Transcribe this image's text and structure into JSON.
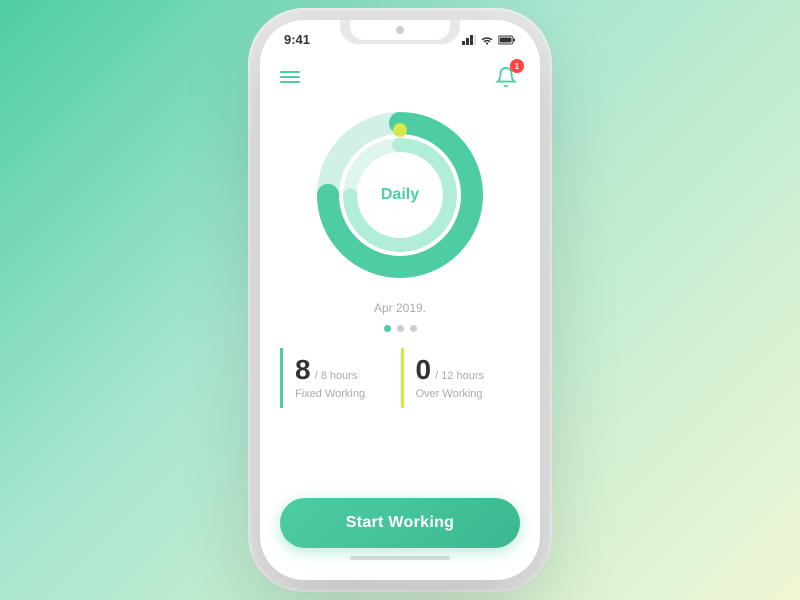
{
  "phone": {
    "status_bar": {
      "time": "9:41",
      "signal": "▲▲▲",
      "wifi": "wifi",
      "battery": "battery"
    },
    "header": {
      "menu_label": "menu",
      "notification_count": "1"
    },
    "chart": {
      "label": "Daily",
      "outer_color": "#4ecda4",
      "inner_color": "#b2edd8",
      "progress": 75,
      "dot_color": "#d4e84a"
    },
    "date_label": "Apr 2019.",
    "pagination": {
      "dots": [
        true,
        false,
        false
      ]
    },
    "stats": [
      {
        "number": "8",
        "of_text": "/ 8 hours",
        "label": "Fixed Working",
        "accent_color": "#4ecda4"
      },
      {
        "number": "0",
        "of_text": "/ 12 hours",
        "label": "Over Working",
        "accent_color": "#d4e84a"
      }
    ],
    "button": {
      "label": "Start Working"
    }
  }
}
